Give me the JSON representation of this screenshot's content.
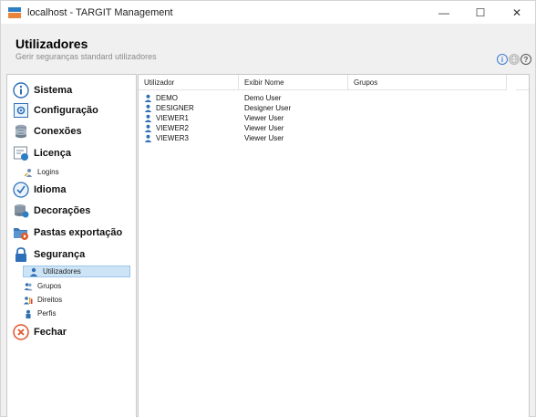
{
  "window": {
    "title": "localhost - TARGIT Management",
    "minimize_glyph": "—",
    "maximize_glyph": "☐",
    "close_glyph": "✕"
  },
  "header": {
    "title": "Utilizadores",
    "subtitle": "Gerir seguranças standard utilizadores",
    "icons": [
      "info-icon",
      "globe-icon",
      "help-icon"
    ]
  },
  "sidebar": {
    "items": [
      {
        "label": "Sistema",
        "icon": "info-circle-icon"
      },
      {
        "label": "Configuração",
        "icon": "configuration-icon"
      },
      {
        "label": "Conexões",
        "icon": "database-icon"
      },
      {
        "label": "Licença",
        "icon": "license-icon"
      },
      {
        "label": "Logins",
        "icon": "key-user-icon",
        "sub": true
      },
      {
        "label": "Idioma",
        "icon": "language-icon"
      },
      {
        "label": "Decorações",
        "icon": "decorations-icon"
      },
      {
        "label": "Pastas exportação",
        "icon": "export-folder-icon"
      },
      {
        "label": "Segurança",
        "icon": "lock-icon"
      },
      {
        "label": "Utilizadores",
        "icon": "user-icon",
        "sub": true,
        "selected": true
      },
      {
        "label": "Grupos",
        "icon": "group-icon",
        "sub": true
      },
      {
        "label": "Direitos",
        "icon": "rights-icon",
        "sub": true
      },
      {
        "label": "Perfis",
        "icon": "profile-icon",
        "sub": true
      },
      {
        "label": "Fechar",
        "icon": "close-circle-icon"
      }
    ]
  },
  "grid": {
    "columns": [
      "Utilizador",
      "Exibir Nome",
      "Grupos"
    ],
    "rows": [
      {
        "user": "DEMO",
        "display": "Demo User",
        "groups": ""
      },
      {
        "user": "DESIGNER",
        "display": "Designer User",
        "groups": ""
      },
      {
        "user": "VIEWER1",
        "display": "Viewer User",
        "groups": ""
      },
      {
        "user": "VIEWER2",
        "display": "Viewer User",
        "groups": ""
      },
      {
        "user": "VIEWER3",
        "display": "Viewer User",
        "groups": ""
      }
    ]
  },
  "colors": {
    "selection_bg": "#cde4f7",
    "selection_border": "#9cc6ea",
    "user_icon": "#2f6fb5",
    "accent_blue": "#3a7bd5"
  }
}
